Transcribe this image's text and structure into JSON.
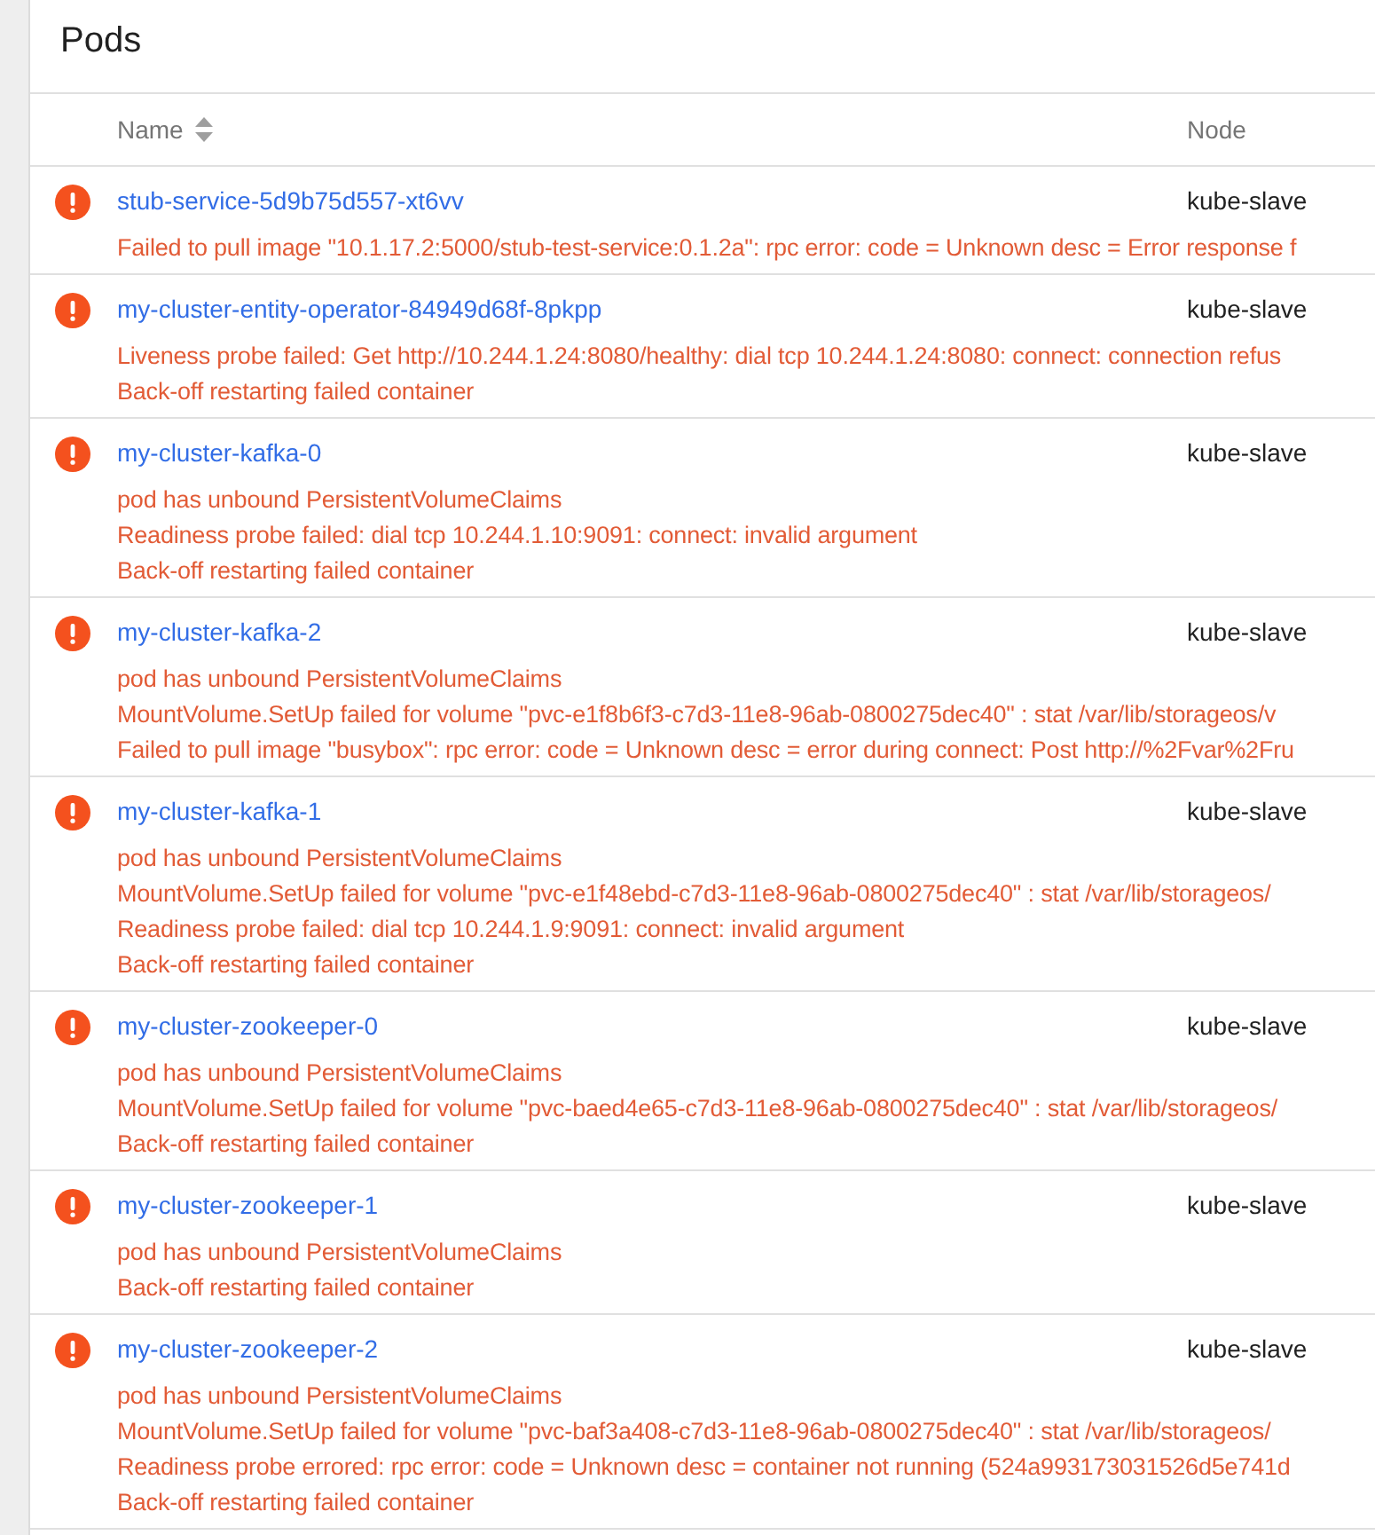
{
  "title": "Pods",
  "table": {
    "columns": [
      {
        "label": "Name",
        "sortable": true
      },
      {
        "label": "Node",
        "sortable": false
      }
    ],
    "rows": [
      {
        "kind": "error",
        "name": "stub-service-5d9b75d557-xt6vv",
        "node": "kube-slave",
        "messages": [
          "Failed to pull image \"10.1.17.2:5000/stub-test-service:0.1.2a\": rpc error: code = Unknown desc = Error response f"
        ]
      },
      {
        "kind": "error",
        "name": "my-cluster-entity-operator-84949d68f-8pkpp",
        "node": "kube-slave",
        "messages": [
          "Liveness probe failed: Get http://10.244.1.24:8080/healthy: dial tcp 10.244.1.24:8080: connect: connection refus",
          "Back-off restarting failed container"
        ]
      },
      {
        "kind": "error",
        "name": "my-cluster-kafka-0",
        "node": "kube-slave",
        "messages": [
          "pod has unbound PersistentVolumeClaims",
          "Readiness probe failed: dial tcp 10.244.1.10:9091: connect: invalid argument",
          "Back-off restarting failed container"
        ]
      },
      {
        "kind": "error",
        "name": "my-cluster-kafka-2",
        "node": "kube-slave",
        "messages": [
          "pod has unbound PersistentVolumeClaims",
          "MountVolume.SetUp failed for volume \"pvc-e1f8b6f3-c7d3-11e8-96ab-0800275dec40\" : stat /var/lib/storageos/v",
          "Failed to pull image \"busybox\": rpc error: code = Unknown desc = error during connect: Post http://%2Fvar%2Fru"
        ]
      },
      {
        "kind": "error",
        "name": "my-cluster-kafka-1",
        "node": "kube-slave",
        "messages": [
          "pod has unbound PersistentVolumeClaims",
          "MountVolume.SetUp failed for volume \"pvc-e1f48ebd-c7d3-11e8-96ab-0800275dec40\" : stat /var/lib/storageos/",
          "Readiness probe failed: dial tcp 10.244.1.9:9091: connect: invalid argument",
          "Back-off restarting failed container"
        ]
      },
      {
        "kind": "error",
        "name": "my-cluster-zookeeper-0",
        "node": "kube-slave",
        "messages": [
          "pod has unbound PersistentVolumeClaims",
          "MountVolume.SetUp failed for volume \"pvc-baed4e65-c7d3-11e8-96ab-0800275dec40\" : stat /var/lib/storageos/",
          "Back-off restarting failed container"
        ]
      },
      {
        "kind": "error",
        "name": "my-cluster-zookeeper-1",
        "node": "kube-slave",
        "messages": [
          "pod has unbound PersistentVolumeClaims",
          "Back-off restarting failed container"
        ]
      },
      {
        "kind": "error",
        "name": "my-cluster-zookeeper-2",
        "node": "kube-slave",
        "messages": [
          "pod has unbound PersistentVolumeClaims",
          "MountVolume.SetUp failed for volume \"pvc-baf3a408-c7d3-11e8-96ab-0800275dec40\" : stat /var/lib/storageos/",
          "Readiness probe errored: rpc error: code = Unknown desc = container not running (524a993173031526d5e741d",
          "Back-off restarting failed container"
        ]
      }
    ]
  }
}
